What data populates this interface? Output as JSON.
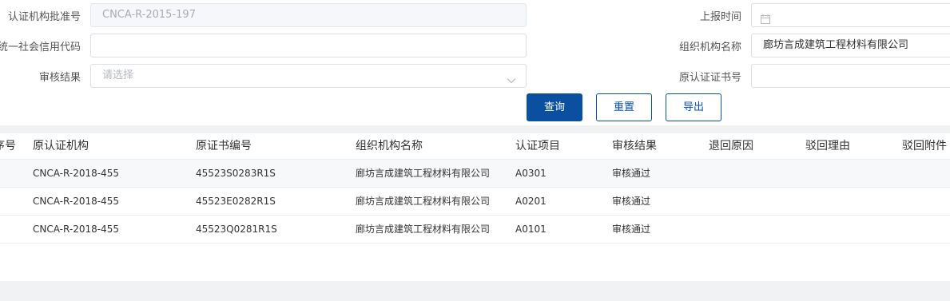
{
  "form": {
    "cert_no_label": "认证机构批准号",
    "cert_no_value": "CNCA-R-2015-197",
    "report_time_label": "上报时间",
    "report_time_value": "",
    "credit_code_label": "统一社会信用代码",
    "credit_code_value": "",
    "org_name_label": "组织机构名称",
    "org_name_value": "廊坊言成建筑工程材料有限公司",
    "audit_result_label": "审核结果",
    "audit_result_placeholder": "请选择",
    "orig_cert_no_label": "原认证证书号",
    "orig_cert_no_value": ""
  },
  "buttons": {
    "query": "查询",
    "reset": "重置",
    "export": "导出"
  },
  "table": {
    "headers": [
      "序号",
      "原认证机构",
      "原证书编号",
      "组织机构名称",
      "认证项目",
      "审核结果",
      "退回原因",
      "驳回理由",
      "驳回附件"
    ],
    "rows": [
      {
        "seq": "",
        "orig_org": "CNCA-R-2018-455",
        "orig_cert": "45523S0283R1S",
        "org_name": "廊坊言成建筑工程材料有限公司",
        "project": "A0301",
        "result": "审核通过",
        "return_reason": "",
        "reject_reason": "",
        "reject_attachment": ""
      },
      {
        "seq": "",
        "orig_org": "CNCA-R-2018-455",
        "orig_cert": "45523E0282R1S",
        "org_name": "廊坊言成建筑工程材料有限公司",
        "project": "A0201",
        "result": "审核通过",
        "return_reason": "",
        "reject_reason": "",
        "reject_attachment": ""
      },
      {
        "seq": "",
        "orig_org": "CNCA-R-2018-455",
        "orig_cert": "45523Q0281R1S",
        "org_name": "廊坊言成建筑工程材料有限公司",
        "project": "A0101",
        "result": "审核通过",
        "return_reason": "",
        "reject_reason": "",
        "reject_attachment": ""
      }
    ]
  },
  "icons": {
    "calendar": "calendar-icon",
    "dropdown": "chevron-down-icon"
  },
  "colors": {
    "primary": "#0b4fa0",
    "border": "#dcdfe6",
    "separator": "#f1f2f4"
  }
}
